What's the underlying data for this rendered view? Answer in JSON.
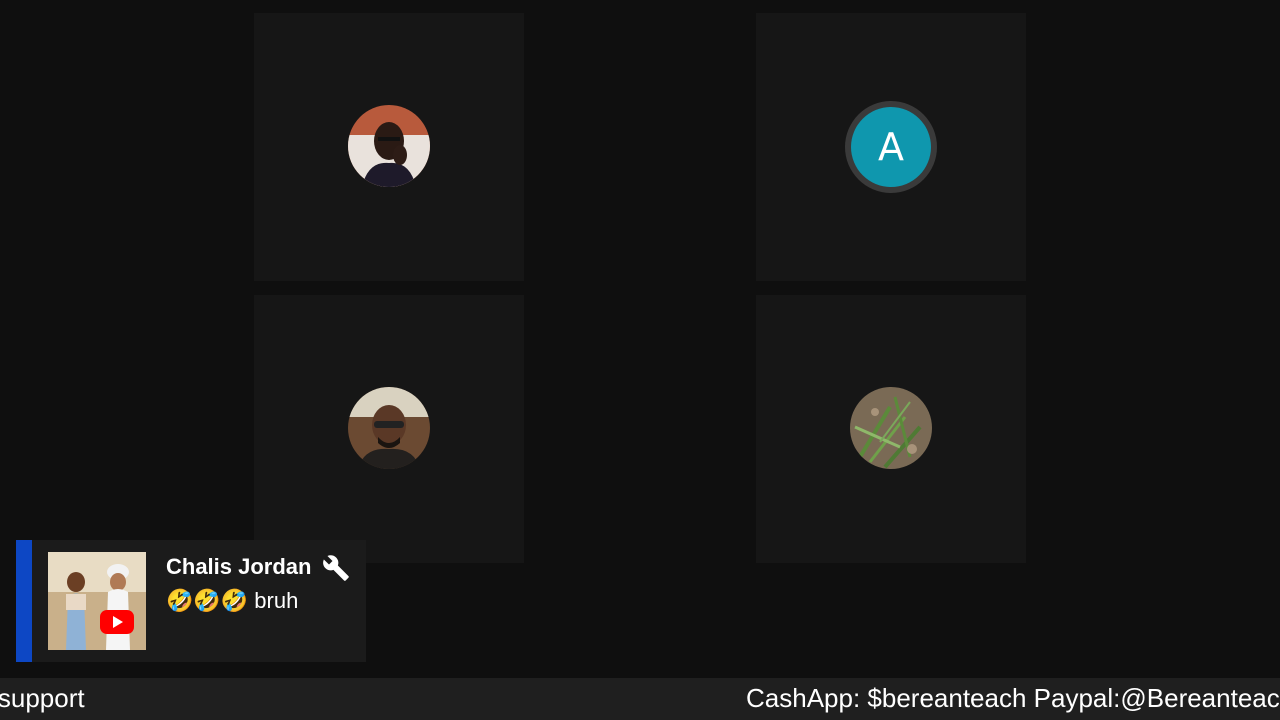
{
  "participants": [
    {
      "type": "photo",
      "icon": "person-portrait"
    },
    {
      "type": "letter",
      "letter": "A",
      "color": "#0f97ae"
    },
    {
      "type": "photo",
      "icon": "person-portrait"
    },
    {
      "type": "photo",
      "icon": "grass-photo"
    }
  ],
  "chat": {
    "author": "Chalis Jordan",
    "author_badge_icon": "wrench-icon",
    "message": "🤣🤣🤣 bruh",
    "accent_color": "#0d47c4",
    "source_icon": "youtube-icon"
  },
  "ticker": {
    "left_text": "r support",
    "right_text": "CashApp: $bereanteach Paypal:@Bereanteach"
  }
}
